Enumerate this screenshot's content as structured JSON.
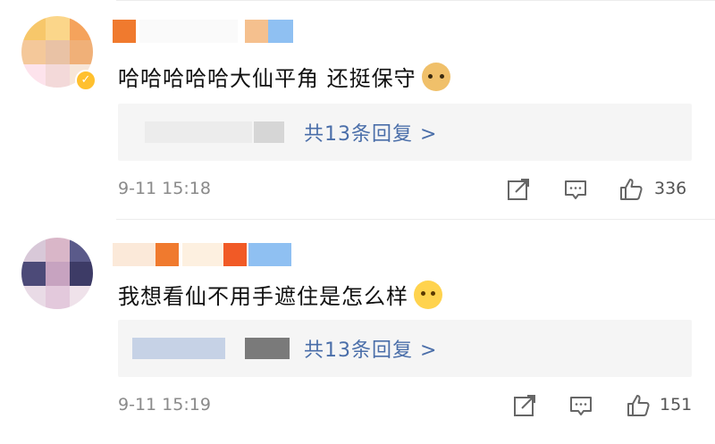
{
  "comments": [
    {
      "content": "哈哈哈哈哈大仙平角 还挺保守",
      "emoji": "doge-emoji",
      "replies_label": "共13条回复 >",
      "time": "9-11 15:18",
      "likes": "336",
      "verified": true
    },
    {
      "content": "我想看仙不用手遮住是怎么样",
      "emoji": "thinking-emoji",
      "replies_label": "共13条回复 >",
      "time": "9-11 15:19",
      "likes": "151",
      "verified": false
    }
  ],
  "colors": {
    "link_blue": "#4a6ea9",
    "gray_text": "#8a8a8a",
    "reply_bg": "#f5f5f5",
    "verified_badge": "#ffc02e"
  },
  "icons": [
    "share-icon",
    "comment-icon",
    "like-icon"
  ]
}
